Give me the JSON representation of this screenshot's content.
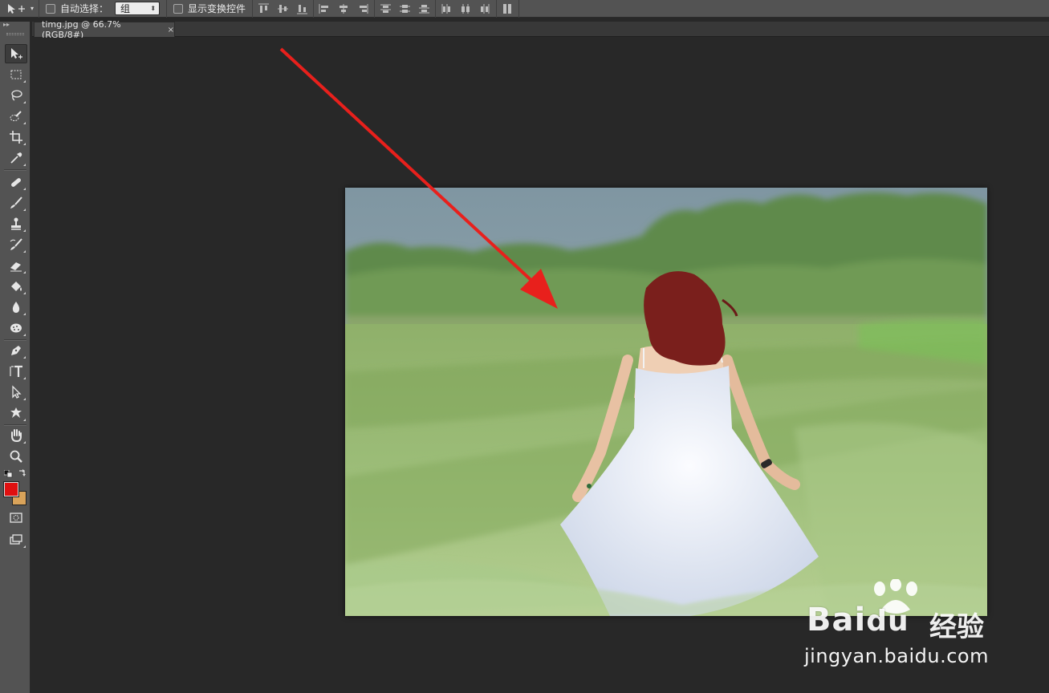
{
  "options_bar": {
    "auto_select_label": "自动选择：",
    "auto_select_value": "组",
    "show_transform_label": "显示变换控件"
  },
  "document_tab": {
    "title": "timg.jpg @ 66.7%(RGB/8#)",
    "close": "×"
  },
  "toolbox": {
    "tools": [
      "move-tool",
      "marquee-tool",
      "lasso-tool",
      "quick-selection-tool",
      "crop-tool",
      "eyedropper-tool",
      "healing-brush-tool",
      "brush-tool",
      "clone-stamp-tool",
      "history-brush-tool",
      "eraser-tool",
      "paint-bucket-tool",
      "blur-tool",
      "dodge-tool",
      "pen-tool",
      "type-tool",
      "path-selection-tool",
      "custom-shape-tool",
      "hand-tool",
      "zoom-tool"
    ],
    "foreground_color": "#e01010",
    "background_color": "#d9a35a"
  },
  "annotation": {
    "arrow_color": "#e8201c"
  },
  "watermark": {
    "brand": "Bai",
    "brand_du": "du",
    "chinese": "经验",
    "url": "jingyan.baidu.com"
  }
}
